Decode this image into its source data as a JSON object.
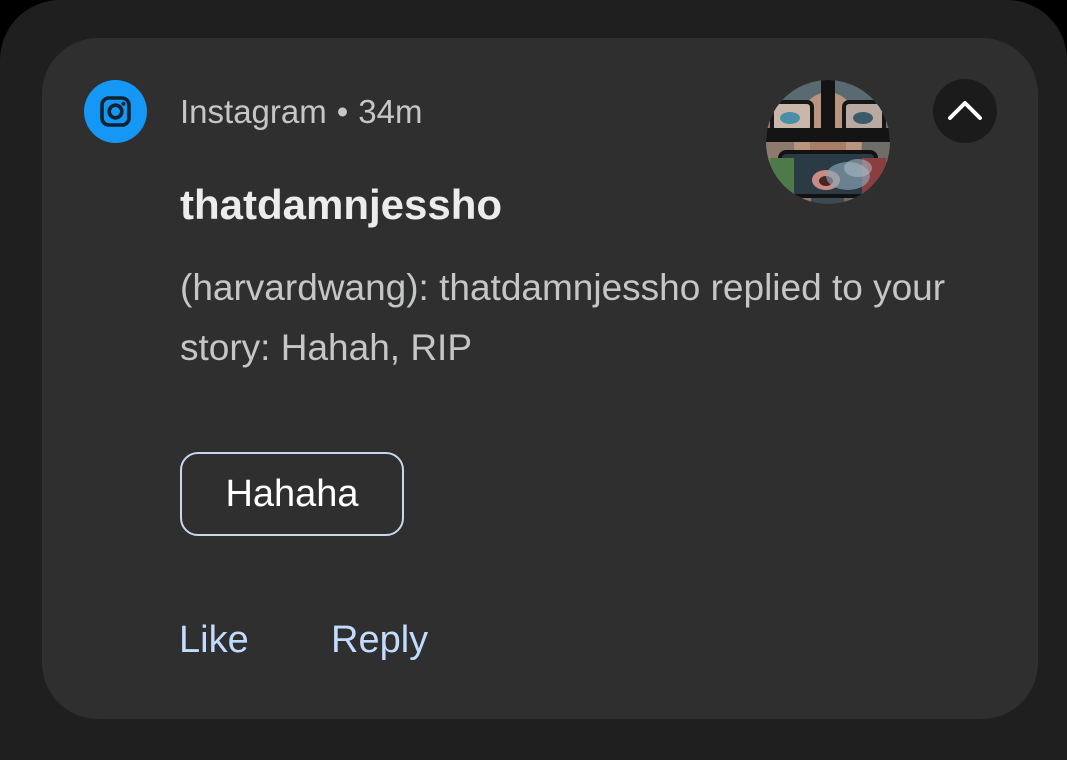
{
  "notification": {
    "app_name": "Instagram",
    "separator": "•",
    "time_ago": "34m",
    "app_icon": "instagram-icon",
    "sender": "thatdamnjessho",
    "message": "(harvardwang): thatdamnjessho replied to your story: Hahah, RIP",
    "avatar": "sender-avatar",
    "collapse_icon": "chevron-up-icon",
    "smart_reply": "Hahaha",
    "actions": {
      "like": "Like",
      "reply": "Reply"
    }
  },
  "colors": {
    "card_background": "#2f2f2f",
    "shade_background": "#1f1f1f",
    "app_icon_background": "#1598f5",
    "action_text": "#c2dcff",
    "chip_border": "#c8d6ee"
  }
}
